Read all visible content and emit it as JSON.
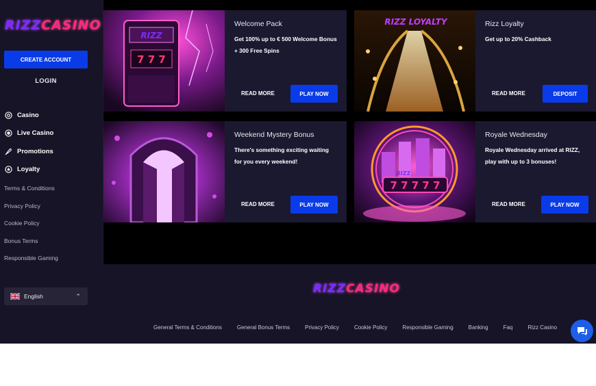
{
  "brand": {
    "part1": "RIZZ",
    "part2": "CASINO"
  },
  "sidebar": {
    "create_account": "CREATE ACCOUNT",
    "login": "LOGIN",
    "nav": [
      {
        "label": "Casino",
        "icon": "casino-chip-icon"
      },
      {
        "label": "Live Casino",
        "icon": "live-casino-icon"
      },
      {
        "label": "Promotions",
        "icon": "rocket-icon"
      },
      {
        "label": "Loyalty",
        "icon": "star-icon"
      }
    ],
    "links": [
      "Terms & Conditions",
      "Privacy Policy",
      "Cookie Policy",
      "Bonus Terms",
      "Responsible Gaming"
    ],
    "language": {
      "label": "English",
      "flag": "uk-flag-icon"
    }
  },
  "promos": [
    {
      "title": "Welcome Pack",
      "desc": "Get 100% up to € 500 Welcome Bonus + 300 Free Spins",
      "read": "READ MORE",
      "cta": "PLAY NOW",
      "image_text": "RIZZ"
    },
    {
      "title": "Rizz Loyalty",
      "desc": "Get up to 20% Cashback",
      "read": "READ MORE",
      "cta": "DEPOSIT",
      "image_text": "RIZZ LOYALTY"
    },
    {
      "title": "Weekend Mystery Bonus",
      "desc": "There's something exciting waiting for you every weekend!",
      "read": "READ MORE",
      "cta": "PLAY NOW",
      "image_text": ""
    },
    {
      "title": "Royale Wednesday",
      "desc": "Royale Wednesday arrived at RIZZ, play with up to 3 bonuses!",
      "read": "READ MORE",
      "cta": "PLAY NOW",
      "image_text": "RIZZ"
    }
  ],
  "footer": {
    "links": [
      "General Terms & Conditions",
      "General Bonus Terms",
      "Privacy Policy",
      "Cookie Policy",
      "Responsible Gaming",
      "Banking",
      "Faq",
      "Rizz Casino"
    ]
  },
  "colors": {
    "accent": "#0a3be8",
    "bg": "#000000",
    "panel": "#161426",
    "card": "#1b1930",
    "logo_purple": "#7a2cff",
    "logo_pink": "#ff2a7a"
  }
}
